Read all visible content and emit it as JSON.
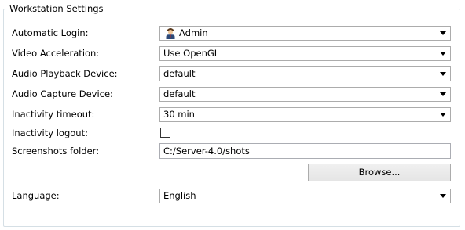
{
  "group": {
    "title": "Workstation Settings"
  },
  "fields": {
    "automatic_login": {
      "label": "Automatic Login:",
      "value": "Admin",
      "icon": "user-icon"
    },
    "video_acceleration": {
      "label": "Video Acceleration:",
      "value": "Use OpenGL"
    },
    "audio_playback": {
      "label": "Audio Playback Device:",
      "value": "default"
    },
    "audio_capture": {
      "label": "Audio Capture Device:",
      "value": "default"
    },
    "inactivity_timeout": {
      "label": "Inactivity timeout:",
      "value": "30 min"
    },
    "inactivity_logout": {
      "label": "Inactivity logout:",
      "checked": false
    },
    "screenshots_folder": {
      "label": "Screenshots folder:",
      "value": "C:/Server-4.0/shots",
      "browse_label": "Browse..."
    },
    "language": {
      "label": "Language:",
      "value": "English"
    }
  },
  "colors": {
    "group_border": "#d5dfe5",
    "combo_border": "#acacac",
    "button_gradient_top": "#f0f0f0",
    "button_gradient_bottom": "#e5e5e5"
  }
}
